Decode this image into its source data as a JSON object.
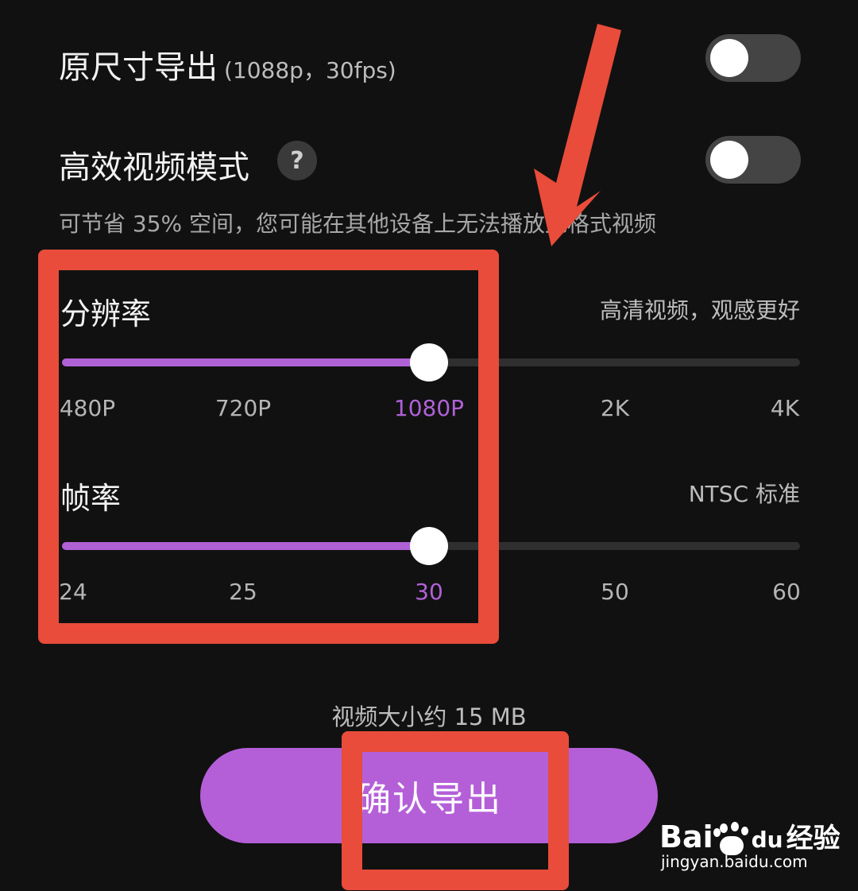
{
  "original_size": {
    "title": "原尺寸导出",
    "subtitle": "(1088p，30fps)",
    "enabled": false
  },
  "efficient_mode": {
    "title": "高效视频模式",
    "help_glyph": "?",
    "enabled": false,
    "description": "可节省 35% 空间，您可能在其他设备上无法播放此格式视频"
  },
  "resolution": {
    "label": "分辨率",
    "hint": "高清视频，观感更好",
    "options": [
      "480P",
      "720P",
      "1080P",
      "2K",
      "4K"
    ],
    "selected": "1080P",
    "selected_index": 2
  },
  "frame_rate": {
    "label": "帧率",
    "hint": "NTSC 标准",
    "options": [
      "24",
      "25",
      "30",
      "50",
      "60"
    ],
    "selected": "30",
    "selected_index": 2
  },
  "video_size": "视频大小约 15 MB",
  "confirm_button": "确认导出",
  "watermark": {
    "brand": "Bai",
    "brand2": "du",
    "product": "经验",
    "url": "jingyan.baidu.com"
  },
  "colors": {
    "background": "#111111",
    "accent": "#b061d6",
    "annotation": "#e94c3a"
  }
}
